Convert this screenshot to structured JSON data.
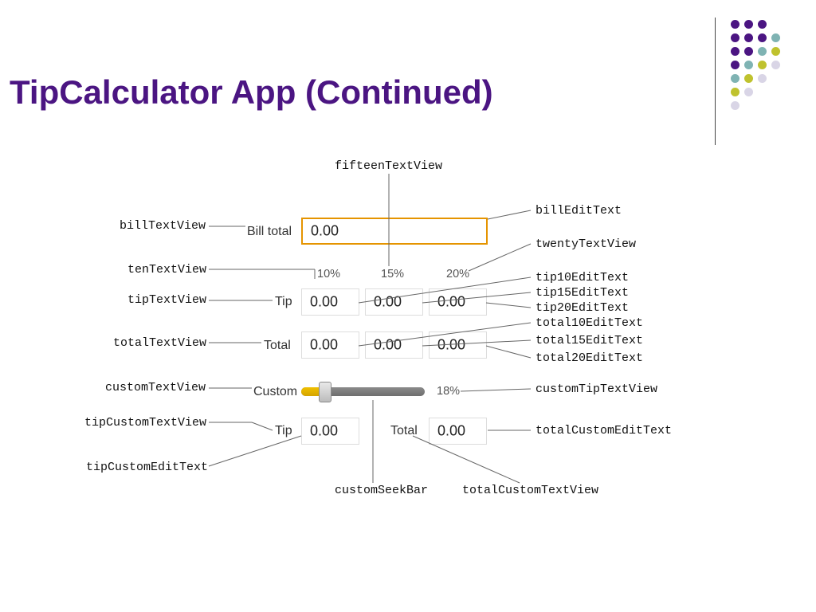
{
  "title": "TipCalculator App (Continued)",
  "callouts": {
    "fifteenTextView": "fifteenTextView",
    "billTextView": "billTextView",
    "tenTextView": "tenTextView",
    "tipTextView": "tipTextView",
    "totalTextView": "totalTextView",
    "customTextView": "customTextView",
    "tipCustomTextView": "tipCustomTextView",
    "tipCustomEditText": "tipCustomEditText",
    "customSeekBar": "customSeekBar",
    "totalCustomTextView": "totalCustomTextView",
    "billEditText": "billEditText",
    "twentyTextView": "twentyTextView",
    "tip10EditText": "tip10EditText",
    "tip15EditText": "tip15EditText",
    "tip20EditText": "tip20EditText",
    "total10EditText": "total10EditText",
    "total15EditText": "total15EditText",
    "total20EditText": "total20EditText",
    "customTipTextView": "customTipTextView",
    "totalCustomEditText": "totalCustomEditText"
  },
  "rowLabels": {
    "billTotal": "Bill total",
    "ten": "10%",
    "fifteen": "15%",
    "twenty": "20%",
    "tip": "Tip",
    "total": "Total",
    "custom": "Custom",
    "customPct": "18%",
    "tip2": "Tip",
    "total2": "Total"
  },
  "fields": {
    "bill": "0.00",
    "tip10": "0.00",
    "tip15": "0.00",
    "tip20": "0.00",
    "total10": "0.00",
    "total15": "0.00",
    "total20": "0.00",
    "tipCustom": "0.00",
    "totalCustom": "0.00"
  }
}
